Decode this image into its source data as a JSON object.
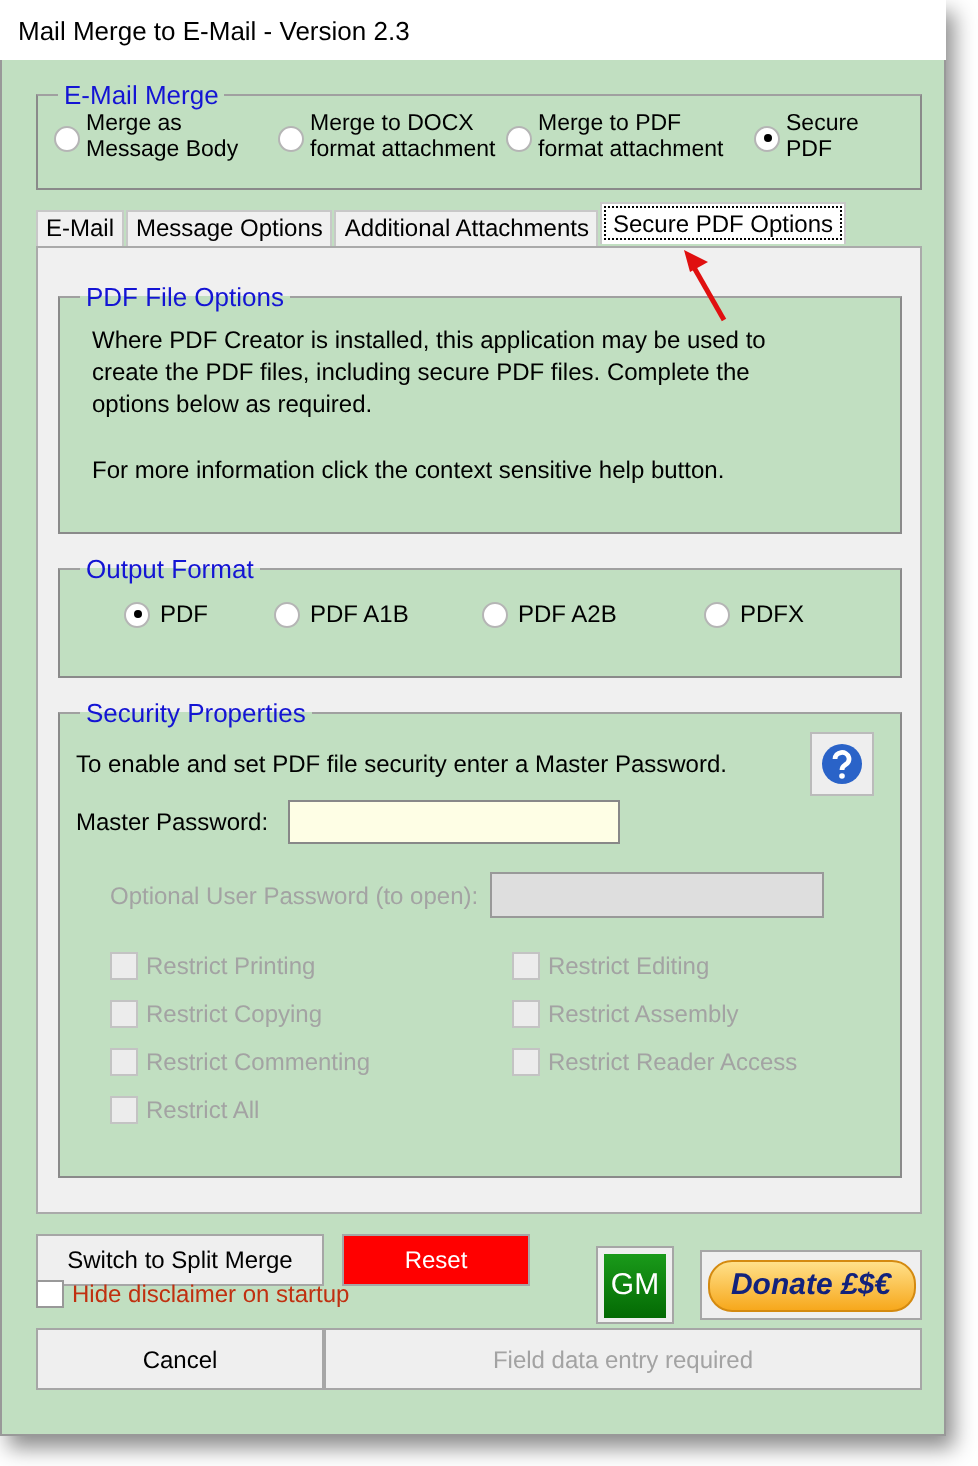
{
  "window": {
    "title": "Mail Merge to E-Mail - Version 2.3"
  },
  "merge_group": {
    "title": "E-Mail Merge",
    "options": [
      {
        "label": "Merge as Message Body",
        "selected": false
      },
      {
        "label": "Merge to DOCX format attachment",
        "selected": false
      },
      {
        "label": "Merge to PDF format attachment",
        "selected": false
      },
      {
        "label": "Secure PDF",
        "selected": true
      }
    ]
  },
  "tabs": [
    {
      "label": "E-Mail",
      "selected": false
    },
    {
      "label": "Message Options",
      "selected": false
    },
    {
      "label": "Additional Attachments",
      "selected": false
    },
    {
      "label": "Secure PDF Options",
      "selected": true
    }
  ],
  "pdf_file_options": {
    "title": "PDF File Options",
    "paragraphs": [
      "Where PDF Creator is installed, this application may be used to create the PDF files, including secure PDF files. Complete the options below as required.",
      "For more information click the context sensitive help button."
    ]
  },
  "output_format": {
    "title": "Output Format",
    "options": [
      {
        "label": "PDF",
        "selected": true
      },
      {
        "label": "PDF A1B",
        "selected": false
      },
      {
        "label": "PDF A2B",
        "selected": false
      },
      {
        "label": "PDFX",
        "selected": false
      }
    ]
  },
  "security": {
    "title": "Security Properties",
    "intro": "To enable and set PDF file security enter a Master Password.",
    "master_password": {
      "label": "Master Password:"
    },
    "user_password": {
      "label": "Optional User Password (to open):",
      "disabled": true
    },
    "restrictions": [
      {
        "label": "Restrict Printing",
        "checked": false,
        "disabled": true
      },
      {
        "label": "Restrict Copying",
        "checked": false,
        "disabled": true
      },
      {
        "label": "Restrict Commenting",
        "checked": false,
        "disabled": true
      },
      {
        "label": "Restrict All",
        "checked": false,
        "disabled": true
      },
      {
        "label": "Restrict Editing",
        "checked": false,
        "disabled": true
      },
      {
        "label": "Restrict Assembly",
        "checked": false,
        "disabled": true
      },
      {
        "label": "Restrict Reader Access",
        "checked": false,
        "disabled": true
      }
    ]
  },
  "buttons": {
    "switch": "Switch to Split Merge",
    "reset": "Reset",
    "gm": "GM",
    "donate": "Donate £$€"
  },
  "hide_disclaimer": {
    "label": "Hide disclaimer on startup",
    "checked": false
  },
  "footer": {
    "cancel": "Cancel",
    "submit": {
      "label": "Field data entry required",
      "disabled": true
    }
  }
}
